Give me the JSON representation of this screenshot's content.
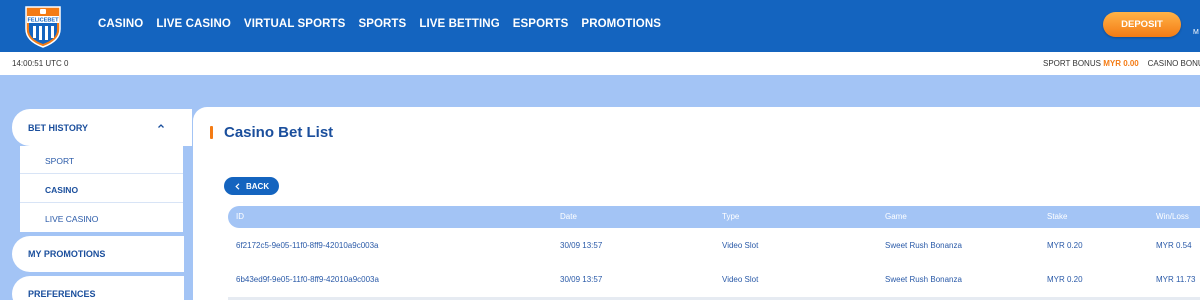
{
  "nav": {
    "logo_text": "FELICEBET",
    "items": [
      "CASINO",
      "LIVE CASINO",
      "VIRTUAL SPORTS",
      "SPORTS",
      "LIVE BETTING",
      "ESPORTS",
      "PROMOTIONS"
    ],
    "deposit_label": "DEPOSIT",
    "menu_stub": "M"
  },
  "infobar": {
    "clock": "14:00:51 UTC 0",
    "sport_bonus_label": "SPORT BONUS",
    "sport_bonus_value": "MYR 0.00",
    "casino_bonus_label": "CASINO BONUS"
  },
  "sidebar": {
    "bet_history_label": "BET HISTORY",
    "sub_items": [
      "SPORT",
      "CASINO",
      "LIVE CASINO"
    ],
    "active_sub": "CASINO",
    "my_promotions_label": "MY PROMOTIONS",
    "preferences_label": "PREFERENCES"
  },
  "main": {
    "title": "Casino Bet List",
    "back_label": "BACK",
    "table": {
      "headers": [
        "ID",
        "Date",
        "Type",
        "Game",
        "Stake",
        "Win/Loss"
      ],
      "rows": [
        [
          "6f2172c5-9e05-11f0-8ff9-42010a9c003a",
          "30/09 13:57",
          "Video Slot",
          "Sweet Rush Bonanza",
          "MYR 0.20",
          "MYR 0.54"
        ],
        [
          "6b43ed9f-9e05-11f0-8ff9-42010a9c003a",
          "30/09 13:57",
          "Video Slot",
          "Sweet Rush Bonanza",
          "MYR 0.20",
          "MYR 11.73"
        ]
      ]
    }
  },
  "colors": {
    "primary": "#1464bf",
    "accent": "#f47b14",
    "background": "#a3c4f5",
    "text_dark": "#1a4e9c"
  },
  "icons": [
    "felicebet-logo",
    "chevron-up-icon",
    "chevron-left-icon"
  ]
}
